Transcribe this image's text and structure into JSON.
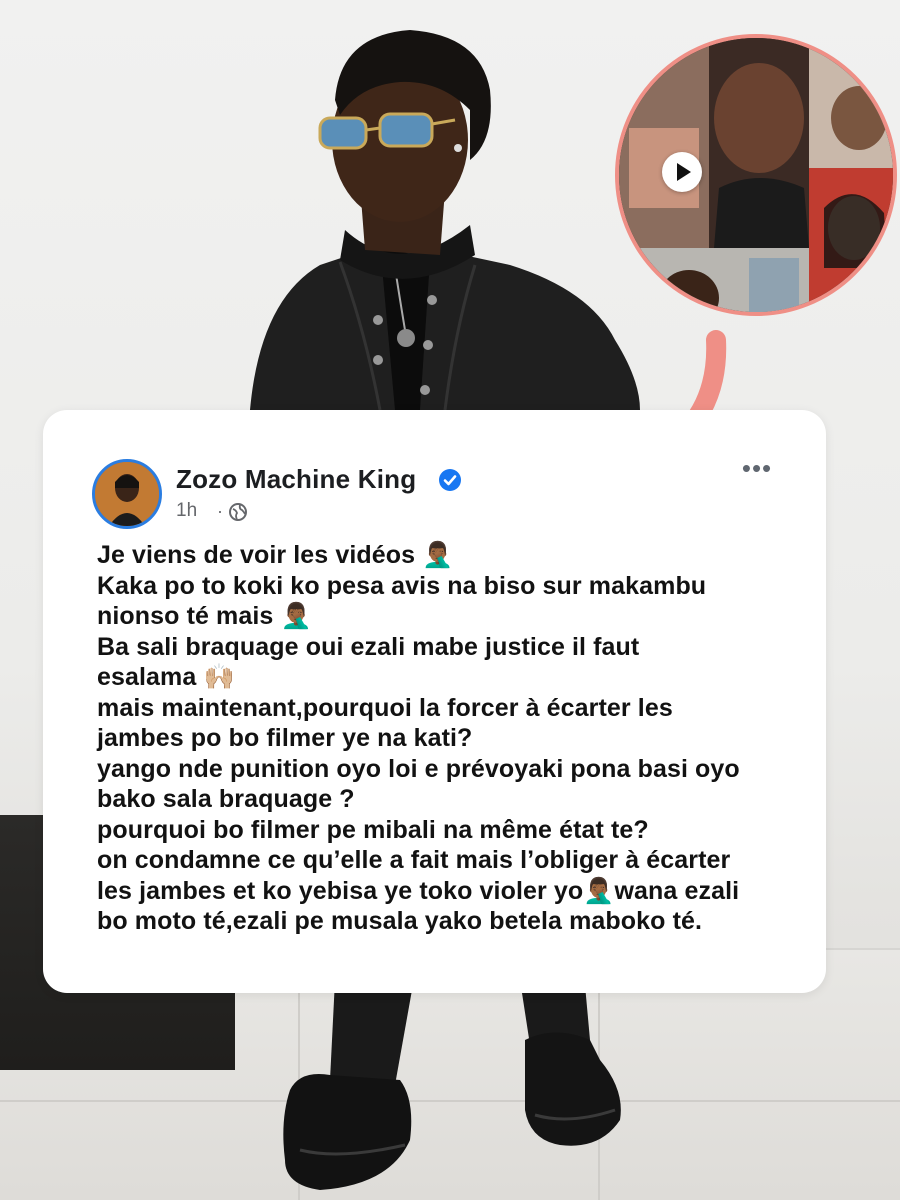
{
  "post": {
    "author_name": "Zozo Machine King",
    "timestamp": "1h",
    "separator": "·",
    "more_menu": "•••",
    "lines": [
      "Je viens de voir les vidéos 🤦🏾‍♂️",
      "Kaka po to koki ko pesa avis na biso sur makambu",
      "nionso té mais 🤦🏾‍♂️",
      "Ba sali braquage oui ezali mabe justice il faut",
      "esalama 🙌🏼",
      "mais maintenant,pourquoi la forcer à écarter les",
      "jambes po bo filmer ye na kati?",
      "yango nde punition oyo loi e prévoyaki pona basi oyo",
      "bako sala braquage ?",
      "pourquoi bo filmer pe mibali na même état te?",
      "on condamne ce qu’elle a fait mais l’obliger à écarter",
      "les jambes et ko yebisa ye toko violer yo🤦🏾‍♂️wana ezali",
      "bo moto té,ezali pe musala yako betela maboko té."
    ]
  },
  "icons": {
    "verified": "verified-badge-icon",
    "globe": "globe-icon",
    "play": "play-icon",
    "arrow": "arrow-icon"
  },
  "colors": {
    "accent_ring": "#ef8f86",
    "verified_blue": "#1877f2",
    "avatar_ring": "#2a7de1",
    "text": "#121212",
    "meta": "#65676b"
  }
}
